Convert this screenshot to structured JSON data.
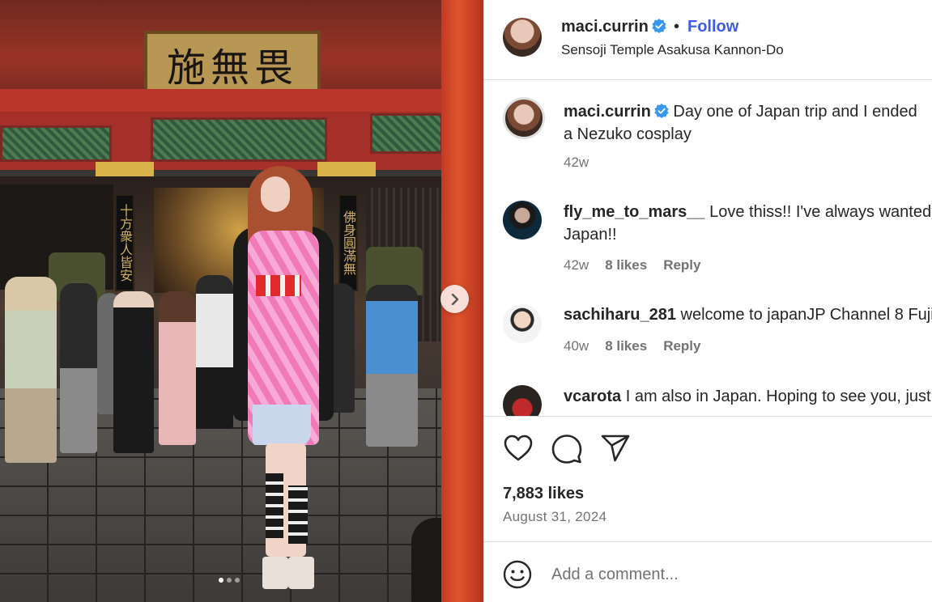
{
  "photo": {
    "sign_text": "施無畏",
    "plaque_left": "十方衆人皆安",
    "plaque_right": "佛身圓滿無",
    "carousel_count": 3,
    "carousel_active_index": 0,
    "next_icon": "chevron-right-icon"
  },
  "header": {
    "username": "maci.currin",
    "verified_icon": "verified-badge-icon",
    "bullet": "•",
    "follow_label": "Follow",
    "location": "Sensoji Temple Asakusa Kannon-Do"
  },
  "caption": {
    "username": "maci.currin",
    "text_line1": "Day one of Japan trip and I ended",
    "text_line2": "a Nezuko cosplay",
    "time": "42w"
  },
  "comments": [
    {
      "username": "fly_me_to_mars__",
      "text_line1": "Love thiss!! I've always wanted",
      "text_line2": "Japan!!",
      "time": "42w",
      "likes": "8 likes",
      "reply": "Reply"
    },
    {
      "username": "sachiharu_281",
      "text_line1": "welcome to japanJP Channel 8 Fuji",
      "time": "40w",
      "likes": "8 likes",
      "reply": "Reply"
    },
    {
      "username": "vcarota",
      "text_line1": "I am also in Japan. Hoping to see you, just"
    }
  ],
  "actions": {
    "like_icon": "heart-icon",
    "comment_icon": "comment-bubble-icon",
    "share_icon": "paper-plane-icon",
    "likes": "7,883 likes",
    "date": "August 31, 2024"
  },
  "add_comment": {
    "emoji_icon": "emoji-smiley-icon",
    "placeholder": "Add a comment..."
  },
  "colors": {
    "follow": "#3d5ae8",
    "verified": "#3897f0",
    "text": "#262626",
    "secondary": "#737373",
    "divider": "#dbdbdb"
  }
}
